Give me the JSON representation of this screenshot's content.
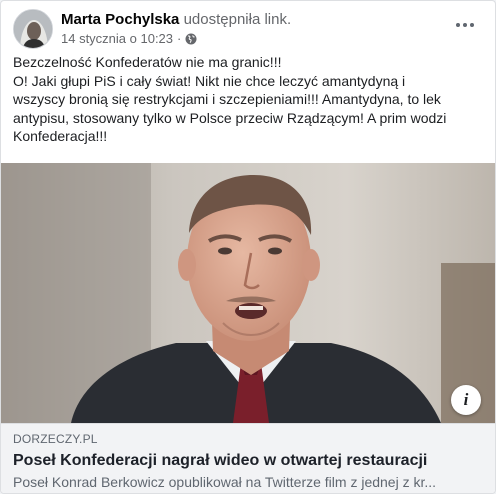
{
  "post": {
    "author": "Marta Pochylska",
    "action": "udostępniła link.",
    "timestamp": "14 stycznia o 10:23",
    "separator": "·",
    "privacy_icon": "globe-icon",
    "menu_icon": "more-horizontal-icon",
    "text_lines": [
      "Bezczelność Konfederatów nie ma granic!!!",
      "O!  Jaki głupi PiS i cały świat! Nikt nie chce leczyć amantydyną i",
      "wszyscy  bronią się restrykcjami i szczepieniami!!! Amantydyna, to lek",
      "antypisu,  stosowany tylko w Polsce przeciw Rządzącym! A prim wodzi",
      "Konfederacja!!!"
    ]
  },
  "link": {
    "domain": "DORZECZY.PL",
    "title": "Poseł Konfederacji nagrał wideo w otwartej restauracji",
    "description": "Poseł Konrad Berkowicz opublikował na Twitterze film z jednej z kr...",
    "info_label": "i"
  },
  "colors": {
    "card_bg": "#ffffff",
    "page_bg": "#f0f2f5",
    "meta_bg": "#f2f3f5",
    "name": "#050505",
    "secondary": "#65676b"
  }
}
